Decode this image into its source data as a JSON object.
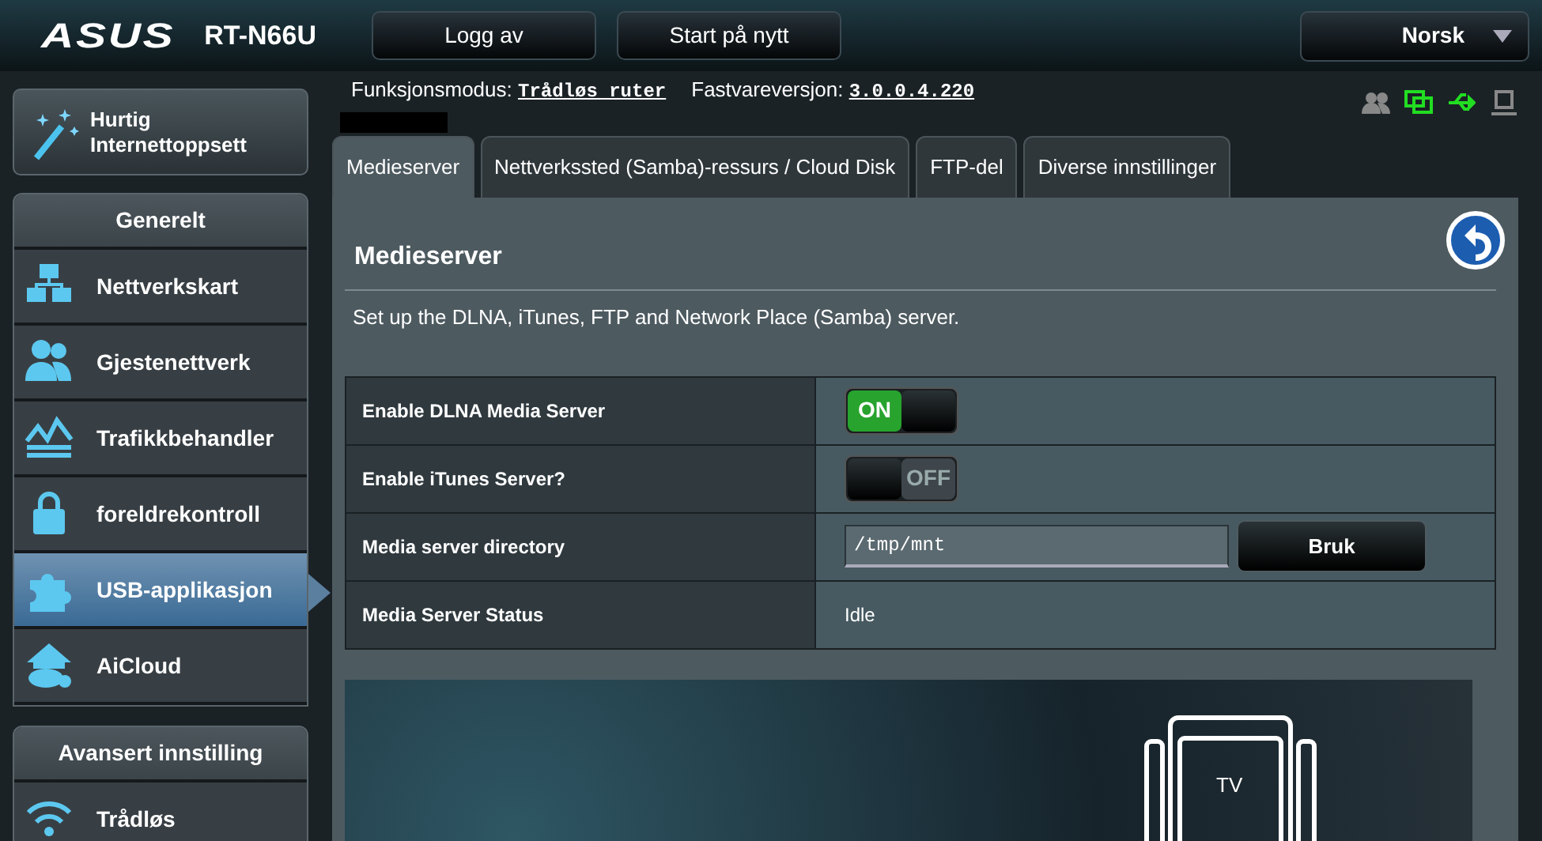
{
  "header": {
    "logo": "ASUS",
    "model": "RT-N66U",
    "buttons": [
      "Logg av",
      "Start på nytt"
    ],
    "language": "Norsk"
  },
  "info": {
    "mode_label": "Funksjonsmodus:",
    "mode_value": "Trådløs ruter",
    "firmware_label": "Fastvareversjon:",
    "firmware_value": "3.0.0.4.220"
  },
  "status_icons": [
    {
      "on": false
    },
    {
      "on": true
    },
    {
      "on": true
    },
    {
      "on": false
    }
  ],
  "quick_setup": {
    "label": "Hurtig Internettoppsett"
  },
  "sidebar": [
    {
      "heading": "Generelt",
      "items": [
        {
          "label": "Nettverkskart",
          "selected": false
        },
        {
          "label": "Gjestenettverk",
          "selected": false
        },
        {
          "label": "Trafikkbehandler",
          "selected": false
        },
        {
          "label": "foreldrekontroll",
          "selected": false
        },
        {
          "label": "USB-applikasjon",
          "selected": true
        },
        {
          "label": "AiCloud",
          "selected": false
        }
      ]
    },
    {
      "heading": "Avansert innstilling",
      "items": [
        {
          "label": "Trådløs",
          "selected": false
        }
      ]
    }
  ],
  "tabs": [
    {
      "label": "Medieserver",
      "selected": true
    },
    {
      "label": "Nettverkssted (Samba)-ressurs / Cloud Disk",
      "selected": false
    },
    {
      "label": "FTP-del",
      "selected": false
    },
    {
      "label": "Diverse innstillinger",
      "selected": false
    }
  ],
  "panel": {
    "title": "Medieserver",
    "description": "Set up the DLNA, iTunes, FTP and Network Place (Samba) server.",
    "rows": [
      {
        "kind": "toggle",
        "label": "Enable DLNA Media Server",
        "on": true,
        "state_text": "ON"
      },
      {
        "kind": "toggle",
        "label": "Enable iTunes Server?",
        "on": false,
        "state_text": "OFF"
      },
      {
        "kind": "input",
        "label": "Media server directory",
        "value": "/tmp/mnt",
        "button": "Bruk"
      },
      {
        "kind": "text",
        "label": "Media Server Status",
        "value": "Idle"
      }
    ]
  },
  "illustration": {
    "tv_label": "TV"
  }
}
